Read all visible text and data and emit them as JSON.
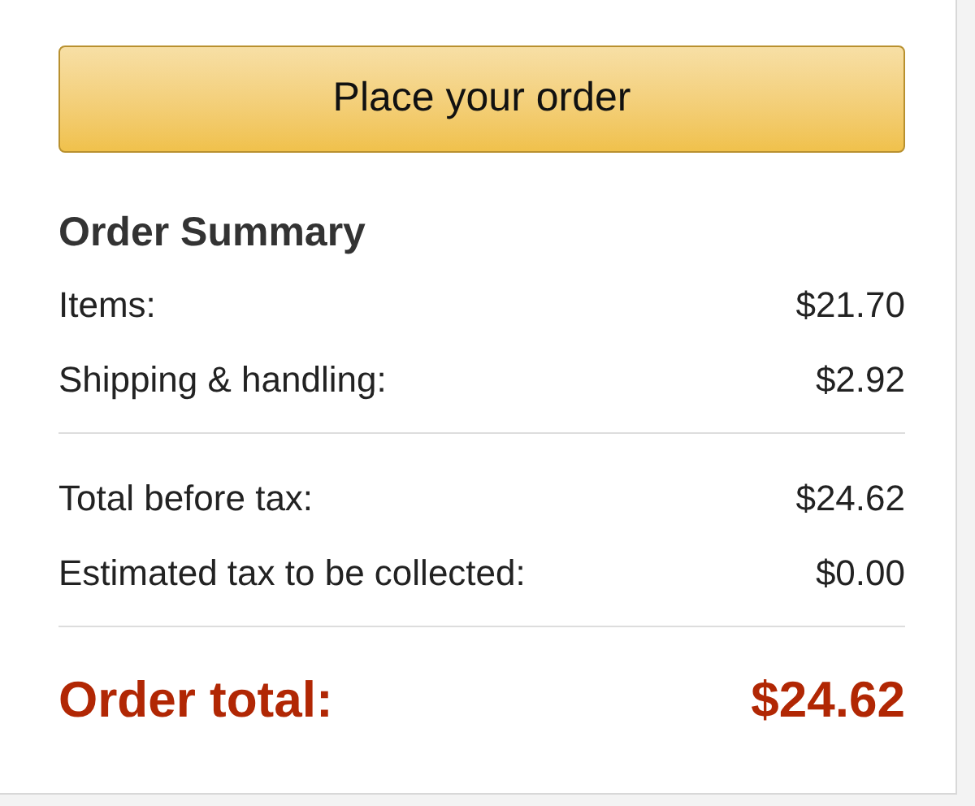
{
  "button": {
    "label": "Place your order"
  },
  "summary": {
    "title": "Order Summary",
    "groups": [
      {
        "rows": [
          {
            "label": "Items:",
            "value": "$21.70"
          },
          {
            "label": "Shipping & handling:",
            "value": "$2.92"
          }
        ]
      },
      {
        "rows": [
          {
            "label": "Total before tax:",
            "value": "$24.62"
          },
          {
            "label": "Estimated tax to be collected:",
            "value": "$0.00"
          }
        ]
      }
    ],
    "total": {
      "label": "Order total:",
      "value": "$24.62"
    }
  }
}
